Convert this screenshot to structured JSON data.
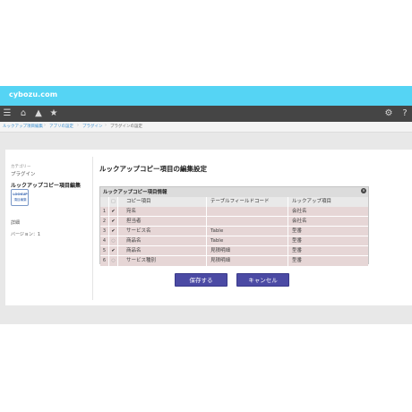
{
  "app": {
    "brand": "cybozu.com"
  },
  "nav": {
    "icons": [
      "menu-icon",
      "home-icon",
      "bell-icon",
      "star-icon",
      "gear-icon",
      "help-icon"
    ]
  },
  "breadcrumb": [
    "ルックアップ項目編集",
    "アプリの設定",
    "プラグイン",
    "プラグインの設定"
  ],
  "sidebar": {
    "category": "カテゴリー",
    "plugin": "プラグイン",
    "plugin_name": "ルックアップコピー項目編集",
    "logo_line1": "LOOKUP",
    "logo_line2": "項目編集",
    "detail": "詳細",
    "version": "バージョン：1"
  },
  "page": {
    "title": "ルックアップコピー項目の編集設定"
  },
  "panel": {
    "title": "ルックアップコピー項目情報",
    "close_glyph": "✕",
    "columns": {
      "check": "□",
      "copy_field": "コピー項目",
      "table_code": "テーブルフィールドコード",
      "lookup_field": "ルックアップ項目"
    },
    "rows": [
      {
        "num": "1",
        "check": "✔",
        "copy_field": "宛名",
        "table_code": "",
        "lookup_field": "会社名"
      },
      {
        "num": "2",
        "check": "✔",
        "copy_field": "担当者",
        "table_code": "",
        "lookup_field": "会社名"
      },
      {
        "num": "3",
        "check": "✔",
        "copy_field": "サービス名",
        "table_code": "Table",
        "lookup_field": "型番"
      },
      {
        "num": "4",
        "check": "○",
        "copy_field": "商品名",
        "table_code": "Table",
        "lookup_field": "型番"
      },
      {
        "num": "5",
        "check": "✔",
        "copy_field": "商品名",
        "table_code": "見積明細",
        "lookup_field": "型番"
      },
      {
        "num": "6",
        "check": "○",
        "copy_field": "サービス種別",
        "table_code": "見積明細",
        "lookup_field": "型番"
      }
    ]
  },
  "buttons": {
    "save": "保存する",
    "cancel": "キャンセル"
  },
  "colors": {
    "topbar": "#55d4f4",
    "navbar": "#454545",
    "button": "#4b4aa4",
    "row": "#e6d6d6"
  }
}
